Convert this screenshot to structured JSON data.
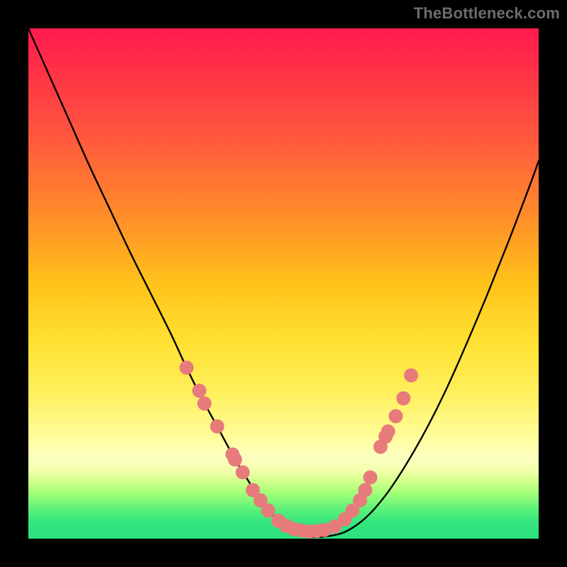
{
  "watermark": {
    "text": "TheBottleneck.com"
  },
  "chart_data": {
    "type": "line",
    "title": "",
    "xlabel": "",
    "ylabel": "",
    "xlim": [
      0,
      100
    ],
    "ylim": [
      0,
      100
    ],
    "grid": false,
    "legend": false,
    "series": [
      {
        "name": "bottleneck-curve",
        "x": [
          0,
          4,
          8,
          12,
          16,
          20,
          24,
          28,
          31,
          34,
          37,
          40,
          43,
          46,
          49,
          52,
          55,
          58,
          62,
          66,
          70,
          74,
          78,
          82,
          86,
          90,
          94,
          98,
          100
        ],
        "y": [
          100,
          91,
          82,
          73,
          64.5,
          56,
          48,
          40,
          33.5,
          27.5,
          22,
          16.5,
          11.5,
          7,
          3.5,
          1.4,
          0.4,
          0.4,
          1.3,
          4.0,
          8.5,
          14.5,
          21.5,
          29.5,
          38.5,
          48.0,
          58.0,
          68.5,
          74.0
        ]
      }
    ],
    "points": {
      "name": "curve-dots",
      "color": "#e77b7b",
      "radius": 10,
      "data": [
        {
          "x": 31.0,
          "y": 33.5
        },
        {
          "x": 33.5,
          "y": 29.0
        },
        {
          "x": 34.5,
          "y": 26.5
        },
        {
          "x": 37.0,
          "y": 22.0
        },
        {
          "x": 40.0,
          "y": 16.5
        },
        {
          "x": 40.5,
          "y": 15.5
        },
        {
          "x": 42.0,
          "y": 13.0
        },
        {
          "x": 44.0,
          "y": 9.5
        },
        {
          "x": 45.5,
          "y": 7.5
        },
        {
          "x": 47.0,
          "y": 5.5
        },
        {
          "x": 49.0,
          "y": 3.5
        },
        {
          "x": 50.5,
          "y": 2.5
        },
        {
          "x": 52.0,
          "y": 1.9
        },
        {
          "x": 53.5,
          "y": 1.6
        },
        {
          "x": 55.0,
          "y": 1.4
        },
        {
          "x": 56.5,
          "y": 1.5
        },
        {
          "x": 58.0,
          "y": 1.7
        },
        {
          "x": 60.0,
          "y": 2.4
        },
        {
          "x": 62.0,
          "y": 3.8
        },
        {
          "x": 63.5,
          "y": 5.5
        },
        {
          "x": 65.0,
          "y": 7.5
        },
        {
          "x": 66.0,
          "y": 9.5
        },
        {
          "x": 67.0,
          "y": 12.0
        },
        {
          "x": 69.0,
          "y": 18.0
        },
        {
          "x": 70.0,
          "y": 20.0
        },
        {
          "x": 70.5,
          "y": 21.0
        },
        {
          "x": 72.0,
          "y": 24.0
        },
        {
          "x": 73.5,
          "y": 27.5
        },
        {
          "x": 75.0,
          "y": 32.0
        }
      ]
    }
  }
}
